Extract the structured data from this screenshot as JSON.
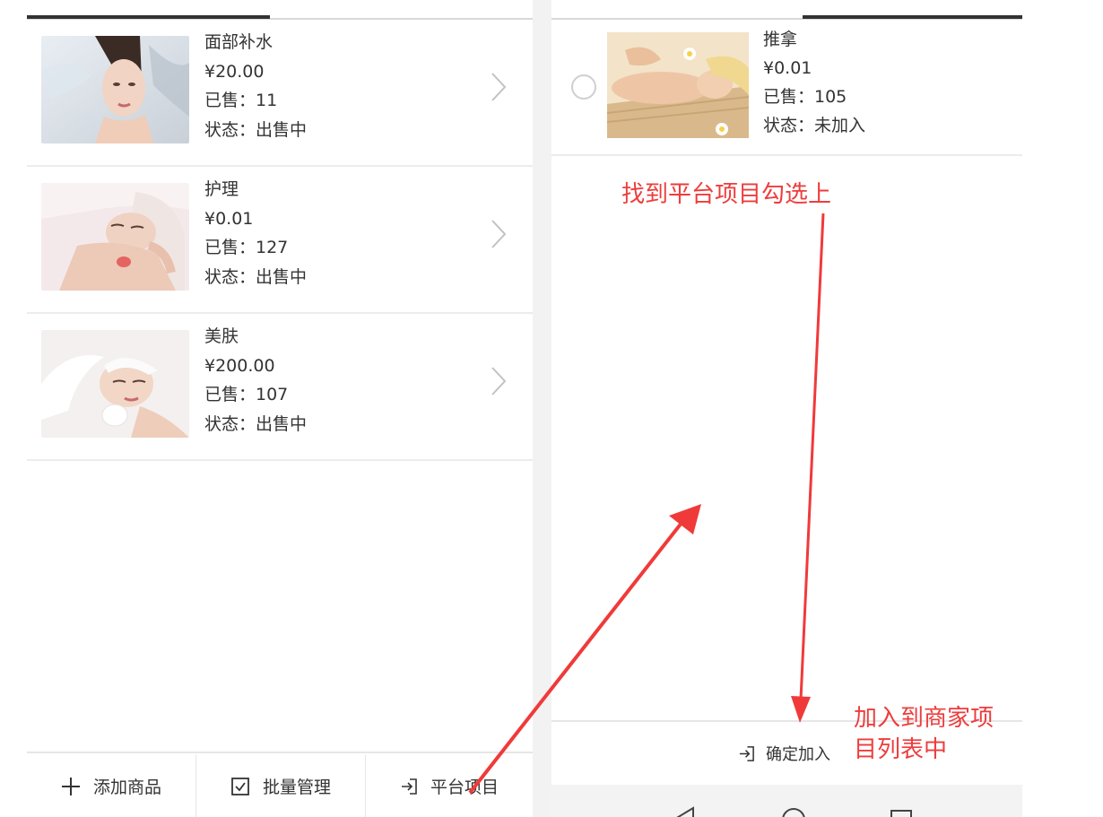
{
  "left_panel": {
    "products": [
      {
        "name": "面部补水",
        "price": "¥20.00",
        "sold": "已售：11",
        "status": "状态：出售中",
        "image": "face-hydration-photo"
      },
      {
        "name": "护理",
        "price": "¥0.01",
        "sold": "已售：127",
        "status": "状态：出售中",
        "image": "face-care-photo"
      },
      {
        "name": "美肤",
        "price": "¥200.00",
        "sold": "已售：107",
        "status": "状态：出售中",
        "image": "skin-beauty-photo"
      }
    ],
    "toolbar": {
      "add_label": "添加商品",
      "batch_label": "批量管理",
      "platform_label": "平台项目"
    }
  },
  "right_panel": {
    "platform_item": {
      "name": "推拿",
      "price": "¥0.01",
      "sold": "已售：105",
      "status": "状态：未加入",
      "image": "massage-photo"
    },
    "confirm_label": "确定加入"
  },
  "annotations": {
    "find_and_select": "找到平台项目勾选上",
    "add_to_list_line1": "加入到商家项",
    "add_to_list_line2": "目列表中",
    "color": "#ee3c3c"
  },
  "icons": {
    "add": "plus-icon",
    "batch": "checkbox-icon",
    "platform": "enter-icon",
    "confirm": "enter-icon",
    "row_arrow": "chevron-right-icon",
    "nav": [
      "back-triangle-icon",
      "home-circle-icon",
      "recents-square-icon"
    ]
  }
}
